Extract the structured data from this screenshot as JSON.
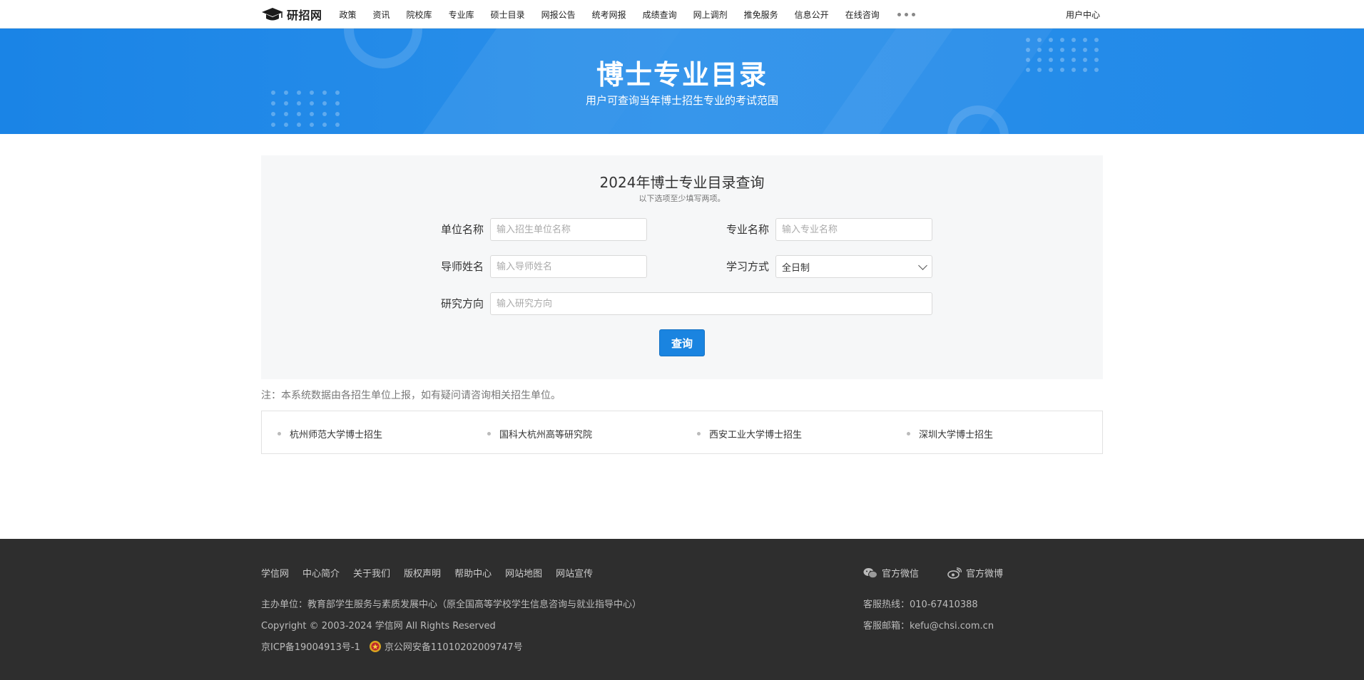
{
  "site": {
    "name": "研招网"
  },
  "nav": {
    "items": [
      "政策",
      "资讯",
      "院校库",
      "专业库",
      "硕士目录",
      "网报公告",
      "统考网报",
      "成绩查询",
      "网上调剂",
      "推免服务",
      "信息公开",
      "在线咨询"
    ],
    "user_center": "用户中心"
  },
  "banner": {
    "title": "博士专业目录",
    "subtitle": "用户可查询当年博士招生专业的考试范围"
  },
  "search": {
    "title": "2024年博士专业目录查询",
    "hint": "以下选项至少填写两项。",
    "unit_label": "单位名称",
    "unit_placeholder": "输入招生单位名称",
    "major_label": "专业名称",
    "major_placeholder": "输入专业名称",
    "tutor_label": "导师姓名",
    "tutor_placeholder": "输入导师姓名",
    "mode_label": "学习方式",
    "mode_value": "全日制",
    "direction_label": "研究方向",
    "direction_placeholder": "输入研究方向",
    "submit_label": "查询"
  },
  "note": "注：本系统数据由各招生单位上报，如有疑问请咨询相关招生单位。",
  "links": [
    "杭州师范大学博士招生",
    "国科大杭州高等研究院",
    "西安工业大学博士招生",
    "深圳大学博士招生"
  ],
  "footer": {
    "links": [
      "学信网",
      "中心简介",
      "关于我们",
      "版权声明",
      "帮助中心",
      "网站地图",
      "网站宣传"
    ],
    "organizer": "主办单位：教育部学生服务与素质发展中心（原全国高等学校学生信息咨询与就业指导中心）",
    "copyright": "Copyright © 2003-2024 学信网 All Rights Reserved",
    "icp": "京ICP备19004913号-1",
    "police": "京公网安备11010202009747号",
    "wechat": "官方微信",
    "weibo": "官方微博",
    "hotline": "客服热线：010-67410388",
    "email": "客服邮箱：kefu@chsi.com.cn"
  },
  "colors": {
    "accent": "#1a84e0",
    "banner": "#1f88e8",
    "footer_bg": "#2e2e2e"
  }
}
